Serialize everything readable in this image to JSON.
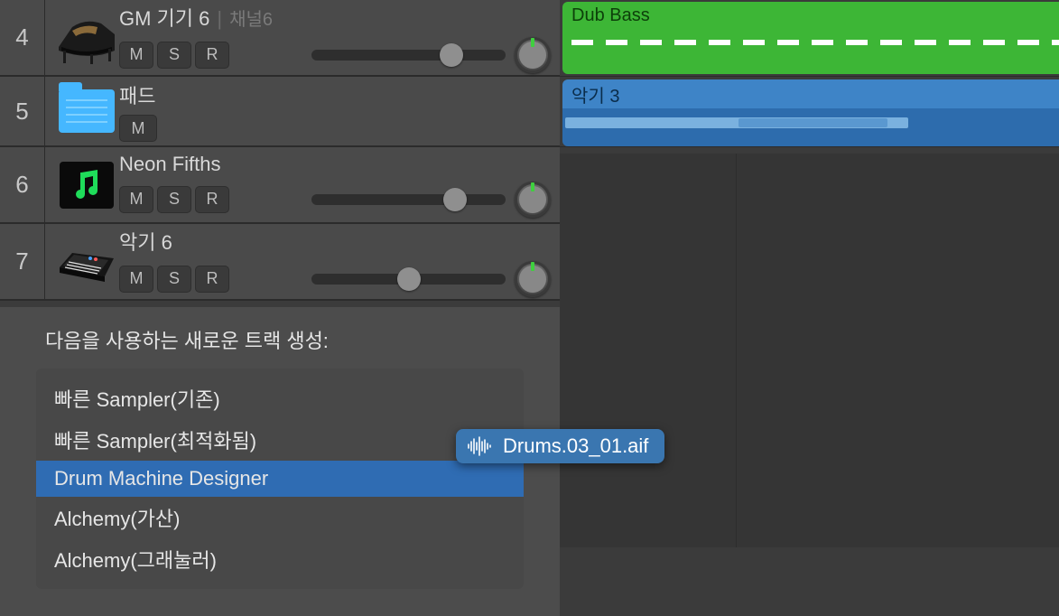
{
  "tracks": [
    {
      "num": "4",
      "name": "GM 기기 6",
      "channel": "채널6",
      "icon": "piano",
      "controls": [
        "M",
        "S",
        "R"
      ],
      "volume": 0.72,
      "pan": true
    },
    {
      "num": "5",
      "name": "패드",
      "channel": "",
      "icon": "folder",
      "controls": [
        "M"
      ],
      "volume": null,
      "pan": false
    },
    {
      "num": "6",
      "name": "Neon Fifths",
      "channel": "",
      "icon": "music",
      "controls": [
        "M",
        "S",
        "R"
      ],
      "volume": 0.74,
      "pan": true
    },
    {
      "num": "7",
      "name": "악기 6",
      "channel": "",
      "icon": "keyboard",
      "controls": [
        "M",
        "S",
        "R"
      ],
      "volume": 0.5,
      "pan": true
    }
  ],
  "regions": {
    "green": {
      "label": "Dub Bass"
    },
    "blue": {
      "label": "악기 3"
    }
  },
  "popup": {
    "title": "다음을 사용하는 새로운 트랙 생성:",
    "items": [
      {
        "label": "빠른 Sampler(기존)",
        "selected": false
      },
      {
        "label": "빠른 Sampler(최적화됨)",
        "selected": false
      },
      {
        "label": "Drum Machine Designer",
        "selected": true
      },
      {
        "label": "Alchemy(가산)",
        "selected": false
      },
      {
        "label": "Alchemy(그래눌러)",
        "selected": false
      }
    ]
  },
  "drag": {
    "filename": "Drums.03_01.aif"
  },
  "btn": {
    "M": "M",
    "S": "S",
    "R": "R"
  }
}
